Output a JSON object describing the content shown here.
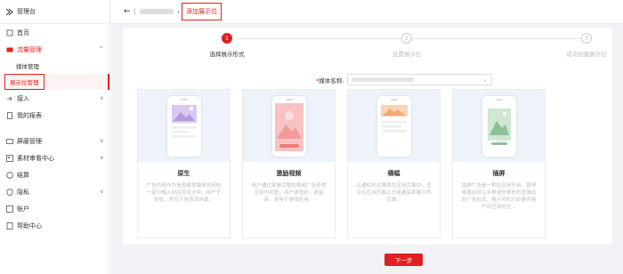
{
  "sidebar": {
    "title": "管理台",
    "items": [
      {
        "label": "首页",
        "icon": "home-icon"
      },
      {
        "label": "流量管理",
        "icon": "traffic-icon",
        "chevron": "^"
      },
      {
        "label": "媒体管理",
        "sub": true
      },
      {
        "label": "展示位管理",
        "sub": true,
        "selected": true
      },
      {
        "label": "接入",
        "icon": "access-icon",
        "chevron": "v"
      },
      {
        "label": "我的报表",
        "icon": "report-icon"
      },
      {
        "label": "屏蔽管理",
        "icon": "block-icon",
        "chevron": "v"
      },
      {
        "label": "素材审看中心",
        "icon": "material-icon",
        "chevron": "v"
      },
      {
        "label": "结算",
        "icon": "settle-icon"
      },
      {
        "label": "隐私",
        "icon": "privacy-icon",
        "chevron": "v"
      },
      {
        "label": "账户",
        "icon": "account-icon"
      },
      {
        "label": "帮助中心",
        "icon": "help-icon"
      }
    ]
  },
  "topbar": {
    "back": "←",
    "sep": "|",
    "gt": "›",
    "crumb": "添加展示位"
  },
  "steps": [
    {
      "num": "1",
      "label": "选择展示形式",
      "active": true
    },
    {
      "num": "2",
      "label": "设置展示位",
      "active": false
    },
    {
      "num": "3",
      "label": "成功创建展示位",
      "active": false
    }
  ],
  "form": {
    "media_label_req": "*",
    "media_label": "媒体名称:"
  },
  "cards": [
    {
      "title": "原生",
      "desc": "广告内容作为信息展现服务内容的一部分融入到应用设计中，用户干扰低，常见于信息流场景。",
      "theme": "#c9b3e8"
    },
    {
      "title": "激励视频",
      "desc": "用户通过观看完整的视频广告获得应用内奖励，用户体验好，收益高，多用于游戏应用。",
      "theme": "#f6a3a3"
    },
    {
      "title": "横幅",
      "desc": "以通栏形式展现在应用页面中，适合在应用页面上方或者底部展示的页面。",
      "theme": "#f3b48a"
    },
    {
      "title": "插屏",
      "desc": "插屏广告是一种在应用开启、暂停或退出时以半屏或全屏的形式弹出的广告形式，展示时机巧妙避开用户对应用的正…",
      "theme": "#9ccfa4"
    }
  ],
  "next_button": "下一步",
  "colors": {
    "accent": "#e02020",
    "bg": "#f0f2f5"
  }
}
